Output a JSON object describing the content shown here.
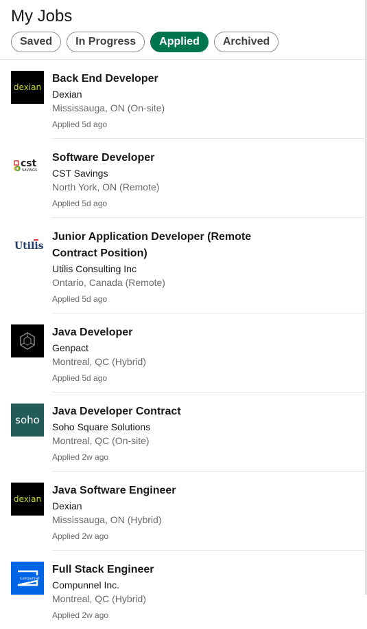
{
  "header": {
    "title": "My Jobs"
  },
  "tabs": [
    {
      "label": "Saved",
      "active": false
    },
    {
      "label": "In Progress",
      "active": false
    },
    {
      "label": "Applied",
      "active": true
    },
    {
      "label": "Archived",
      "active": false
    }
  ],
  "jobs": [
    {
      "title": "Back End Developer",
      "company": "Dexian",
      "location": "Mississauga, ON (On-site)",
      "applied": "Applied 5d ago",
      "logo": "dexian",
      "logo_text": "dexian"
    },
    {
      "title": "Software Developer",
      "company": "CST Savings",
      "location": "North York, ON (Remote)",
      "applied": "Applied 5d ago",
      "logo": "cst",
      "logo_text": "cst savings"
    },
    {
      "title": "Junior Application Developer (Remote Contract Position)",
      "company": "Utilis Consulting Inc",
      "location": "Ontario, Canada (Remote)",
      "applied": "Applied 5d ago",
      "logo": "utilis",
      "logo_text": "Utilis"
    },
    {
      "title": "Java Developer",
      "company": "Genpact",
      "location": "Montreal, QC (Hybrid)",
      "applied": "Applied 5d ago",
      "logo": "genpact",
      "logo_text": ""
    },
    {
      "title": "Java Developer Contract",
      "company": "Soho Square Solutions",
      "location": "Montreal, QC (On-site)",
      "applied": "Applied 2w ago",
      "logo": "soho",
      "logo_text": "soho"
    },
    {
      "title": "Java Software Engineer",
      "company": "Dexian",
      "location": "Mississauga, ON (Hybrid)",
      "applied": "Applied 2w ago",
      "logo": "dexian",
      "logo_text": "dexian"
    },
    {
      "title": "Full Stack Engineer",
      "company": "Compunnel Inc.",
      "location": "Montreal, QC (Hybrid)",
      "applied": "Applied 2w ago",
      "logo": "compunnel",
      "logo_text": "Compunnel"
    }
  ],
  "colors": {
    "accent": "#01754f",
    "dexian_text": "#c9d81a",
    "soho_bg": "#225b57",
    "compunnel_bg": "#0064e6"
  }
}
